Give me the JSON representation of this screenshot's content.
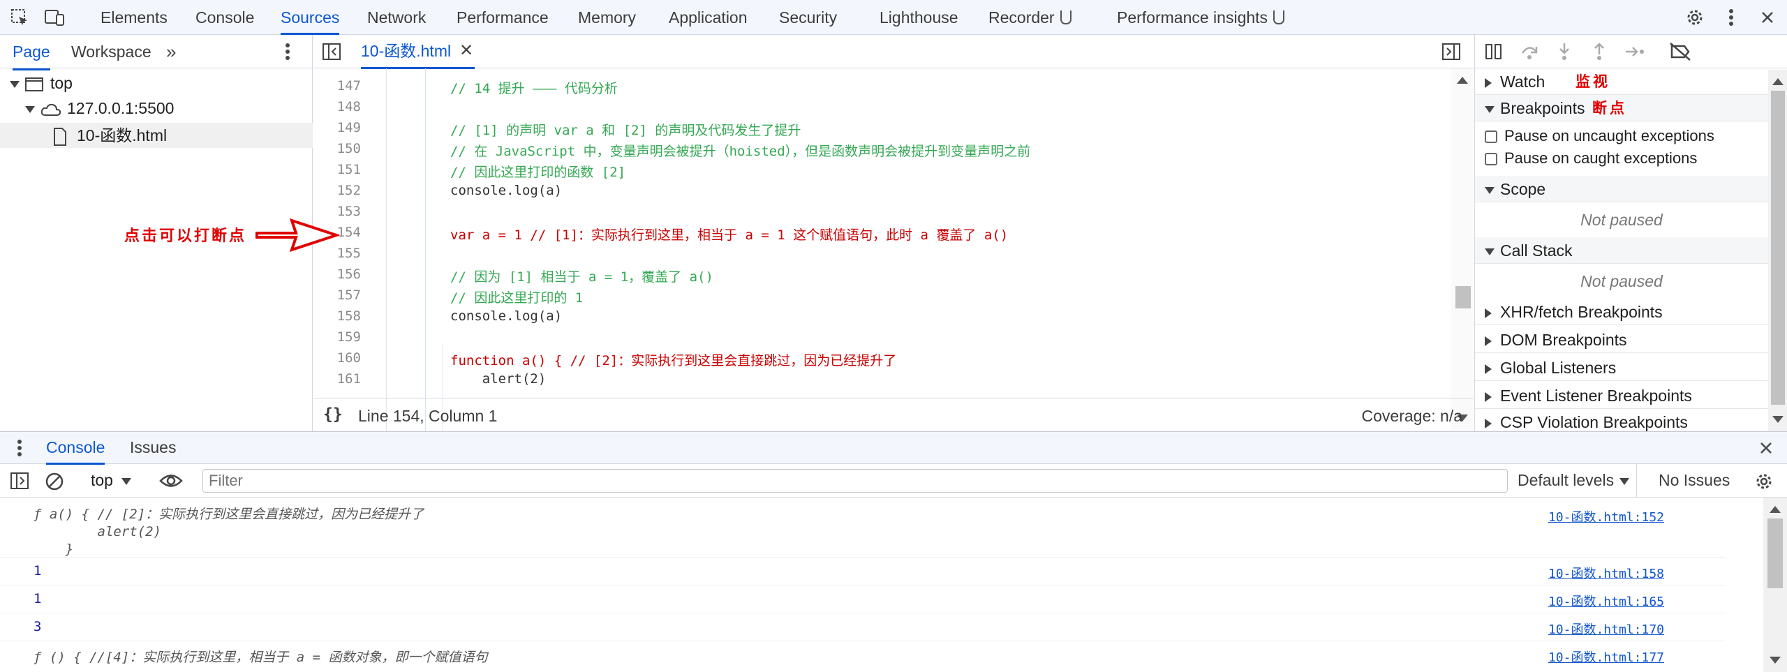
{
  "topbar": {
    "tabs": [
      "Elements",
      "Console",
      "Sources",
      "Network",
      "Performance",
      "Memory",
      "Application",
      "Security",
      "Lighthouse",
      "Recorder",
      "Performance insights"
    ],
    "active": "Sources"
  },
  "nav": {
    "tabs": [
      "Page",
      "Workspace"
    ],
    "tree": {
      "top": "top",
      "host": "127.0.0.1:5500",
      "file": "10-函数.html"
    }
  },
  "editor": {
    "file_tab": "10-函数.html",
    "lines": [
      {
        "n": "147",
        "t": "// 14 提升 ——— 代码分析"
      },
      {
        "n": "148",
        "t": ""
      },
      {
        "n": "149",
        "t": "// [1] 的声明 var a 和 [2] 的声明及代码发生了提升"
      },
      {
        "n": "150",
        "t": "// 在 JavaScript 中，变量声明会被提升（hoisted），但是函数声明会被提升到变量声明之前"
      },
      {
        "n": "151",
        "t": "// 因此这里打印的函数 [2]"
      },
      {
        "n": "152",
        "t": "console.log(a)"
      },
      {
        "n": "153",
        "t": ""
      },
      {
        "n": "154",
        "t": "var a = 1 // [1]：实际执行到这里，相当于 a = 1 这个赋值语句，此时 a 覆盖了 a()"
      },
      {
        "n": "155",
        "t": ""
      },
      {
        "n": "156",
        "t": "// 因为 [1] 相当于 a = 1，覆盖了 a()"
      },
      {
        "n": "157",
        "t": "// 因此这里打印的 1"
      },
      {
        "n": "158",
        "t": "console.log(a)"
      },
      {
        "n": "159",
        "t": ""
      },
      {
        "n": "160",
        "t": "function a() { // [2]：实际执行到这里会直接跳过，因为已经提升了"
      },
      {
        "n": "161",
        "t": "    alert(2)"
      }
    ],
    "status": "Line 154, Column 1",
    "coverage": "Coverage: n/a"
  },
  "annotations": {
    "breakpoint_hint": "点击可以打断点",
    "watch_note": "监视",
    "breakpoints_note": "断点"
  },
  "debug": {
    "watch": "Watch",
    "breakpoints": "Breakpoints",
    "uncaught": "Pause on uncaught exceptions",
    "caught": "Pause on caught exceptions",
    "scope": "Scope",
    "not_paused": "Not paused",
    "callstack": "Call Stack",
    "xhr": "XHR/fetch Breakpoints",
    "dom": "DOM Breakpoints",
    "global": "Global Listeners",
    "event": "Event Listener Breakpoints",
    "csp": "CSP Violation Breakpoints"
  },
  "drawer": {
    "tabs": [
      "Console",
      "Issues"
    ],
    "context": "top",
    "filter_placeholder": "Filter",
    "levels": "Default levels",
    "issues": "No Issues"
  },
  "console": [
    {
      "lines": [
        "ƒ a() { // [2]：实际执行到这里会直接跳过，因为已经提升了",
        "        alert(2)",
        "    }"
      ],
      "src": "10-函数.html:152"
    },
    {
      "lines": [
        "1"
      ],
      "src": "10-函数.html:158"
    },
    {
      "lines": [
        "1"
      ],
      "src": "10-函数.html:165"
    },
    {
      "lines": [
        "3"
      ],
      "src": "10-函数.html:170"
    },
    {
      "lines": [
        "ƒ () { //[4]：实际执行到这里，相当于 a = 函数对象，即一个赋值语句"
      ],
      "src": "10-函数.html:177"
    }
  ]
}
